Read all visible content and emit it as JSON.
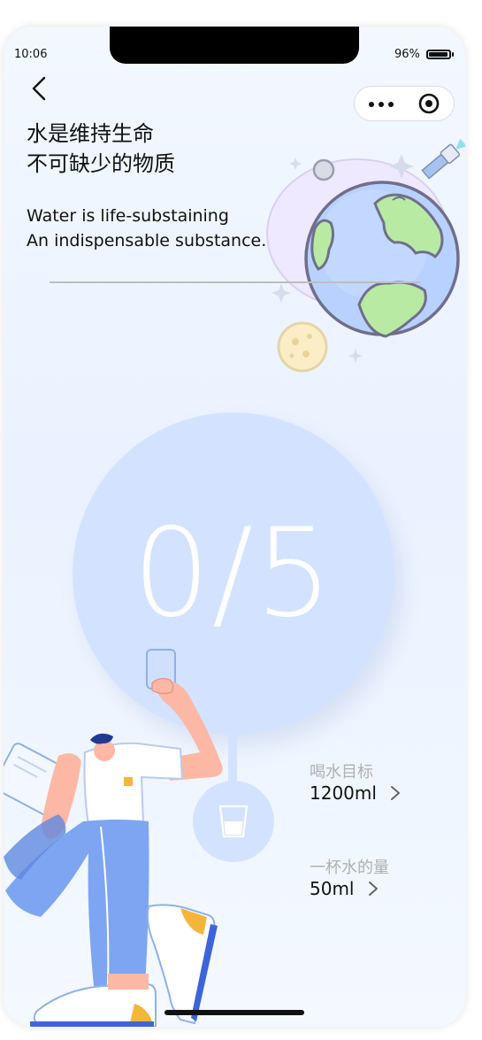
{
  "status": {
    "time": "10:06",
    "battery_text": "96%",
    "battery_level": 0.96
  },
  "headline": {
    "cn_line1": "水是维持生命",
    "cn_line2": "不可缺少的物质",
    "en_line1": "Water is life-substaining",
    "en_line2": "An indispensable substance."
  },
  "progress": {
    "text": "0/5",
    "done": 0,
    "total": 5
  },
  "settings": {
    "goal_label": "喝水目标",
    "goal_value": "1200ml",
    "cup_label": "一杯水的量",
    "cup_value": "50ml"
  },
  "icons": {
    "back": "back-chevron-icon",
    "more": "more-dots-icon",
    "close": "target-circle-icon",
    "cup": "water-cup-icon",
    "chevron": "chevron-right-icon"
  },
  "colors": {
    "circle": "#d3e3ff",
    "accent_text": "#111111",
    "label_text": "#b0b0b0"
  }
}
